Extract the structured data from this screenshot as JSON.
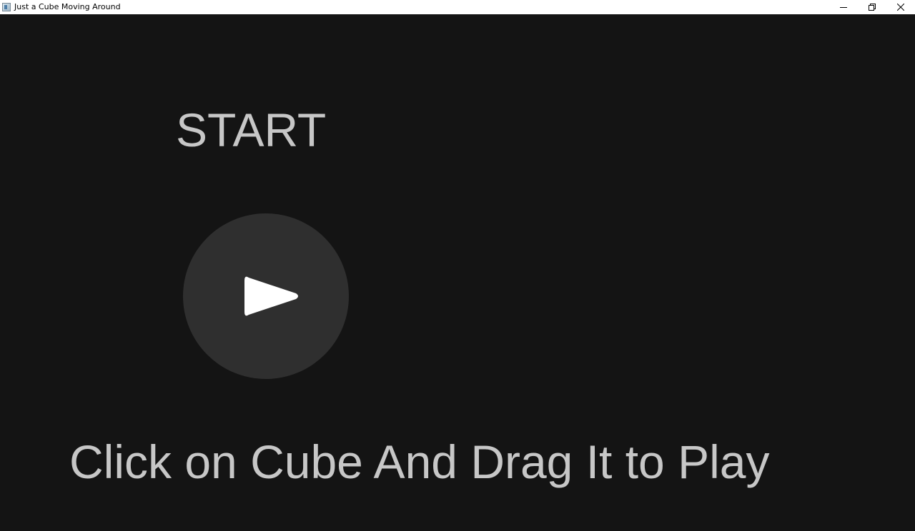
{
  "window": {
    "title": "Just a Cube Moving Around",
    "controls": {
      "minimize_icon": "minimize-icon",
      "restore_icon": "restore-icon",
      "close_icon": "close-icon"
    }
  },
  "game": {
    "start_label": "START",
    "play_icon": "play-icon",
    "hint": "Click on Cube And Drag It to Play",
    "colors": {
      "background": "#141414",
      "text": "#c7c7c7",
      "button_circle": "#2f2f2f",
      "play_triangle": "#ffffff"
    }
  }
}
